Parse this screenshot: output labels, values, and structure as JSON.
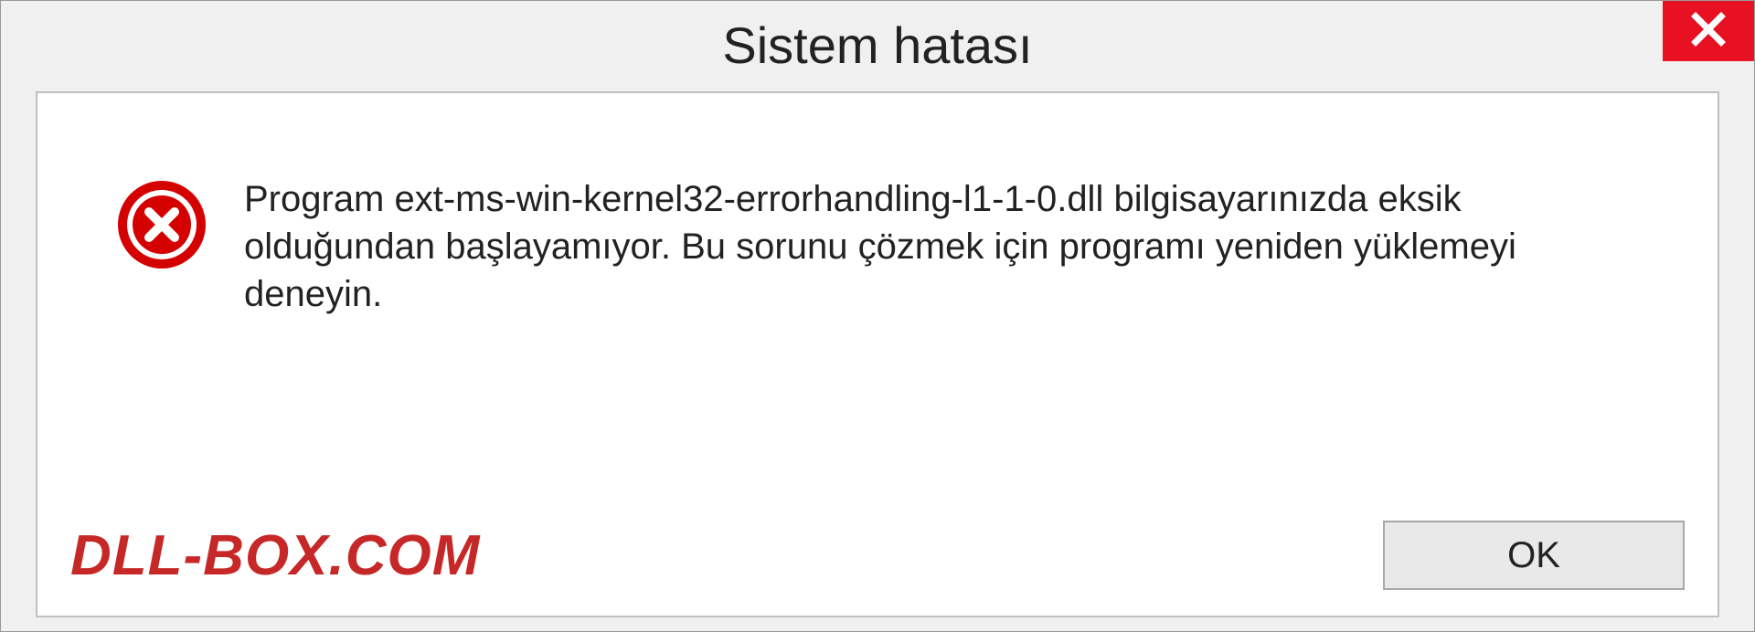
{
  "dialog": {
    "title": "Sistem hatası",
    "message": "Program ext-ms-win-kernel32-errorhandling-l1-1-0.dll bilgisayarınızda eksik olduğundan başlayamıyor. Bu sorunu çözmek için programı yeniden yüklemeyi deneyin.",
    "ok_label": "OK",
    "brand": "DLL-BOX.COM",
    "colors": {
      "close_bg": "#e81123",
      "error_icon": "#d50000",
      "brand": "#c62828"
    }
  }
}
